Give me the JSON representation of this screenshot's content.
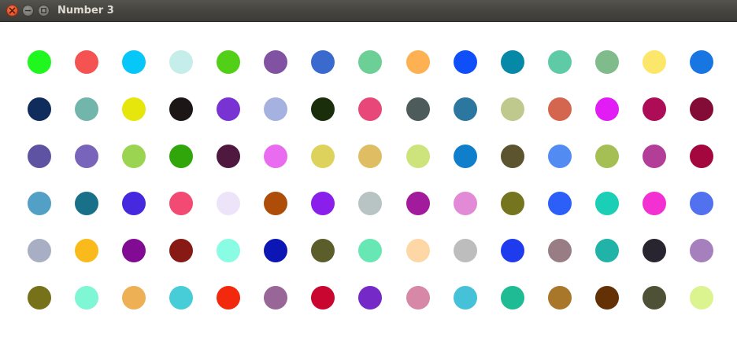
{
  "window": {
    "title": "Number 3",
    "controls": {
      "close": "close-icon",
      "minimize": "minimize-icon",
      "maximize": "maximize-icon"
    }
  },
  "grid": {
    "columns": 15,
    "rows": [
      [
        "#1ff71e",
        "#f55252",
        "#06c7f8",
        "#c5ede9",
        "#52cf17",
        "#8152a1",
        "#3a6acd",
        "#6ccf96",
        "#fdb152",
        "#0f4ff9",
        "#0689a6",
        "#5fcaa6",
        "#7fbb8b",
        "#fce76a",
        "#1876e3"
      ],
      [
        "#0f2c5d",
        "#72b5ab",
        "#e6e60c",
        "#1d1617",
        "#7a33d3",
        "#a5b1df",
        "#1a2e0c",
        "#e8477a",
        "#4e5b5b",
        "#2c779f",
        "#bfc98d",
        "#d46650",
        "#e11cf4",
        "#ad0d57",
        "#830c37"
      ],
      [
        "#5e53a3",
        "#7865bb",
        "#9bd450",
        "#31a60a",
        "#4e183f",
        "#e96bf0",
        "#ddd35c",
        "#dfbd62",
        "#cde37b",
        "#0f7ecb",
        "#5c542f",
        "#528bf1",
        "#a6bf55",
        "#b23e98",
        "#a3073d"
      ],
      [
        "#52a0c6",
        "#187188",
        "#4629de",
        "#f24a72",
        "#ede4fa",
        "#ad4d07",
        "#8a1eeb",
        "#b8c4c3",
        "#a31b9d",
        "#e38ad6",
        "#757520",
        "#2c5ff8",
        "#1bceb6",
        "#f331d2",
        "#5271ef"
      ],
      [
        "#a8afc5",
        "#fbba1c",
        "#810c93",
        "#881a16",
        "#8bfce4",
        "#0c16b4",
        "#5b5e2b",
        "#66e7b4",
        "#fdd8a6",
        "#bdbdbd",
        "#1e3bed",
        "#997d85",
        "#21b2a8",
        "#292530",
        "#a580bd"
      ],
      [
        "#777119",
        "#7ff6d4",
        "#eeb055",
        "#47cdd7",
        "#f3290e",
        "#986697",
        "#c80630",
        "#7529c6",
        "#d688a6",
        "#45c2d8",
        "#1fbb94",
        "#a97729",
        "#643107",
        "#4e5135",
        "#dbf490"
      ]
    ]
  }
}
